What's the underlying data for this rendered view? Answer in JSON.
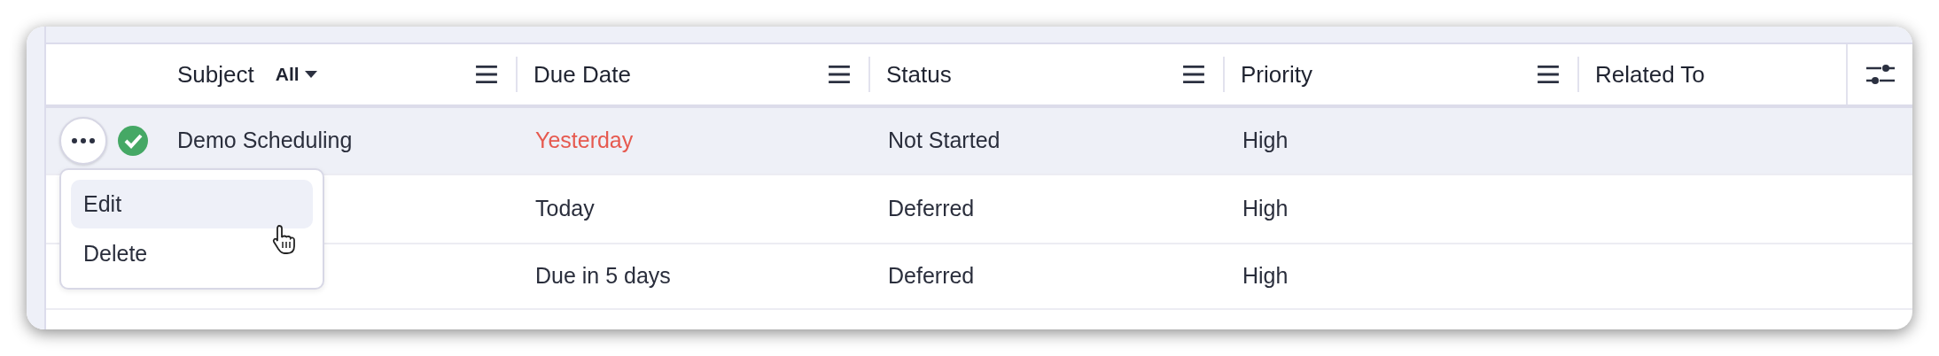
{
  "table": {
    "columns": [
      {
        "label": "Subject",
        "filter": "All",
        "menu": true
      },
      {
        "label": "Due Date",
        "menu": true
      },
      {
        "label": "Status",
        "menu": true
      },
      {
        "label": "Priority",
        "menu": true
      },
      {
        "label": "Related To",
        "menu": false
      }
    ],
    "rows": [
      {
        "highlighted": true,
        "actions_button": true,
        "completed": true,
        "subject": "Demo Scheduling",
        "due_date": "Yesterday",
        "overdue": true,
        "status": "Not Started",
        "priority": "High"
      },
      {
        "highlighted": false,
        "due_date": "Today",
        "overdue": false,
        "status": "Deferred",
        "priority": "High"
      },
      {
        "highlighted": false,
        "due_date": "Due in 5 days",
        "overdue": false,
        "status": "Deferred",
        "priority": "High"
      }
    ]
  },
  "row_menu": {
    "items": [
      {
        "label": "Edit",
        "selected": true
      },
      {
        "label": "Delete",
        "selected": false
      }
    ]
  }
}
